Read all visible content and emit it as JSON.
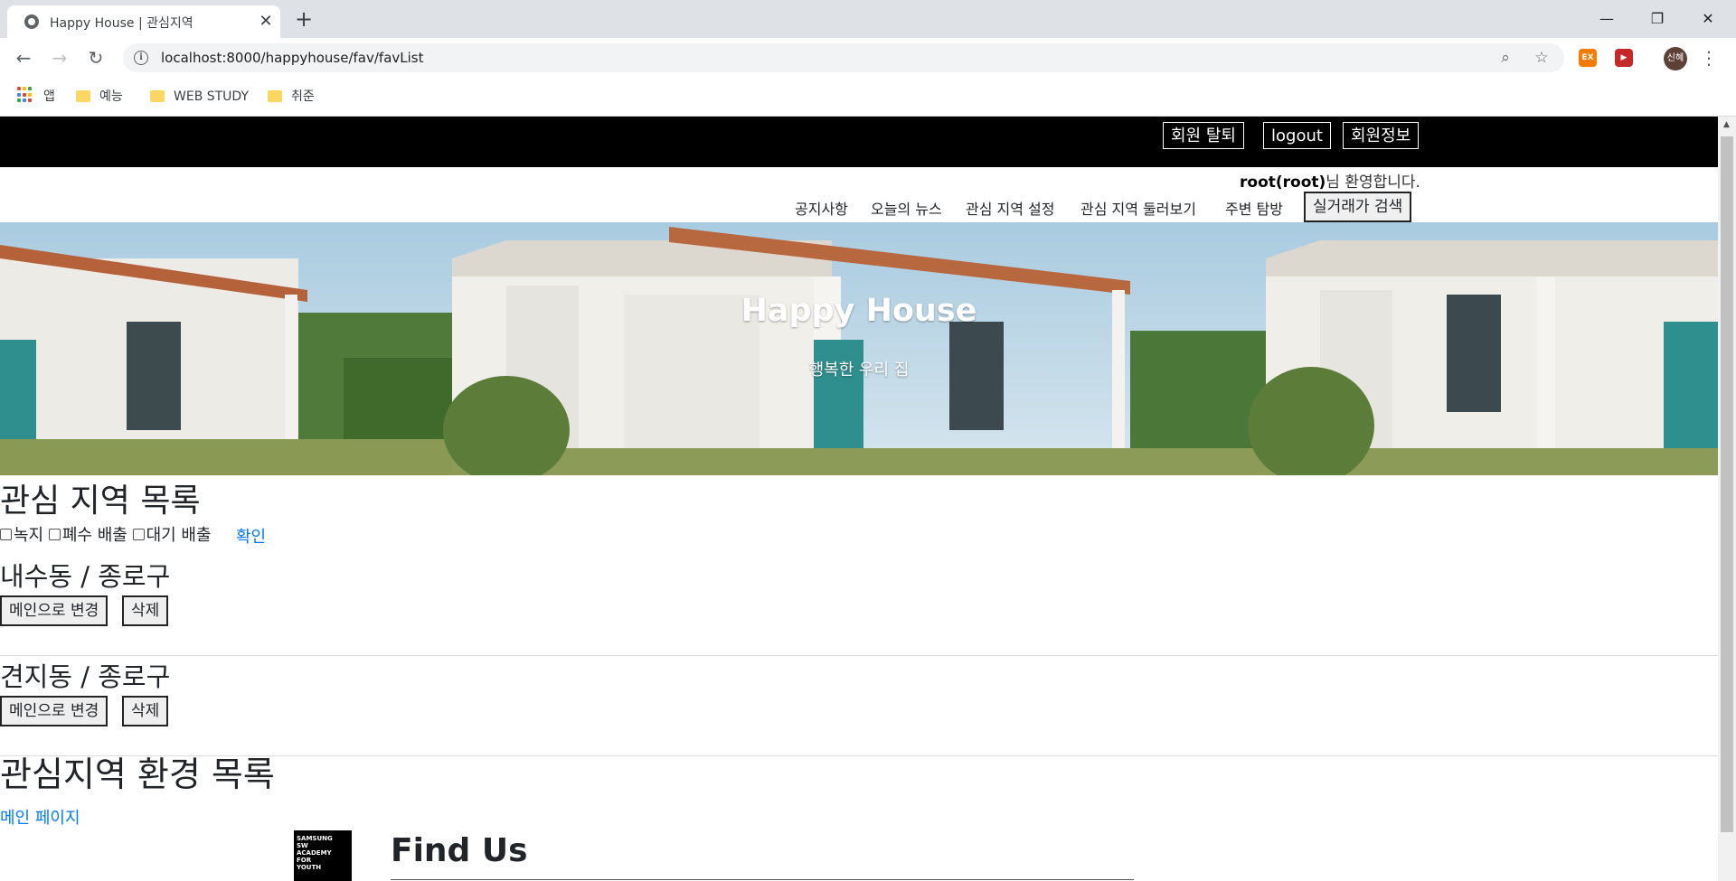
{
  "browser": {
    "tab_title": "Happy House | 관심지역",
    "url": "localhost:8000/happyhouse/fav/favList",
    "bookmarks": [
      {
        "label": "앱"
      },
      {
        "label": "예능"
      },
      {
        "label": "WEB STUDY"
      },
      {
        "label": "취준"
      }
    ],
    "profile_label": "신혜",
    "extensions": [
      "EX",
      "▶"
    ]
  },
  "header": {
    "buttons": {
      "withdraw": "회원 탈퇴",
      "logout": "logout",
      "member_info": "회원정보"
    },
    "welcome_user": "root(root)",
    "welcome_suffix": "님 환영합니다.",
    "nav": {
      "notice": "공지사항",
      "news": "오늘의 뉴스",
      "fav_setting": "관심 지역 설정",
      "fav_browse": "관심 지역 둘러보기",
      "nearby": "주변 탐방",
      "realtime_search": "실거래가 검색"
    }
  },
  "hero": {
    "title": "Happy House",
    "subtitle": "행복한 우리 집"
  },
  "fav": {
    "heading": "관심 지역 목록",
    "filters": [
      "녹지",
      "폐수 배출",
      "대기 배출"
    ],
    "confirm": "확인",
    "items": [
      {
        "name": "내수동 / 종로구",
        "set_main": "메인으로 변경",
        "delete": "삭제"
      },
      {
        "name": "견지동 / 종로구",
        "set_main": "메인으로 변경",
        "delete": "삭제"
      }
    ]
  },
  "env": {
    "heading": "관심지역 환경 목록",
    "main_link": "메인 페이지"
  },
  "footer": {
    "logo_lines": [
      "SAMSUNG",
      "SW",
      "ACADEMY",
      "FOR",
      "YOUTH"
    ],
    "find_us": "Find Us"
  }
}
